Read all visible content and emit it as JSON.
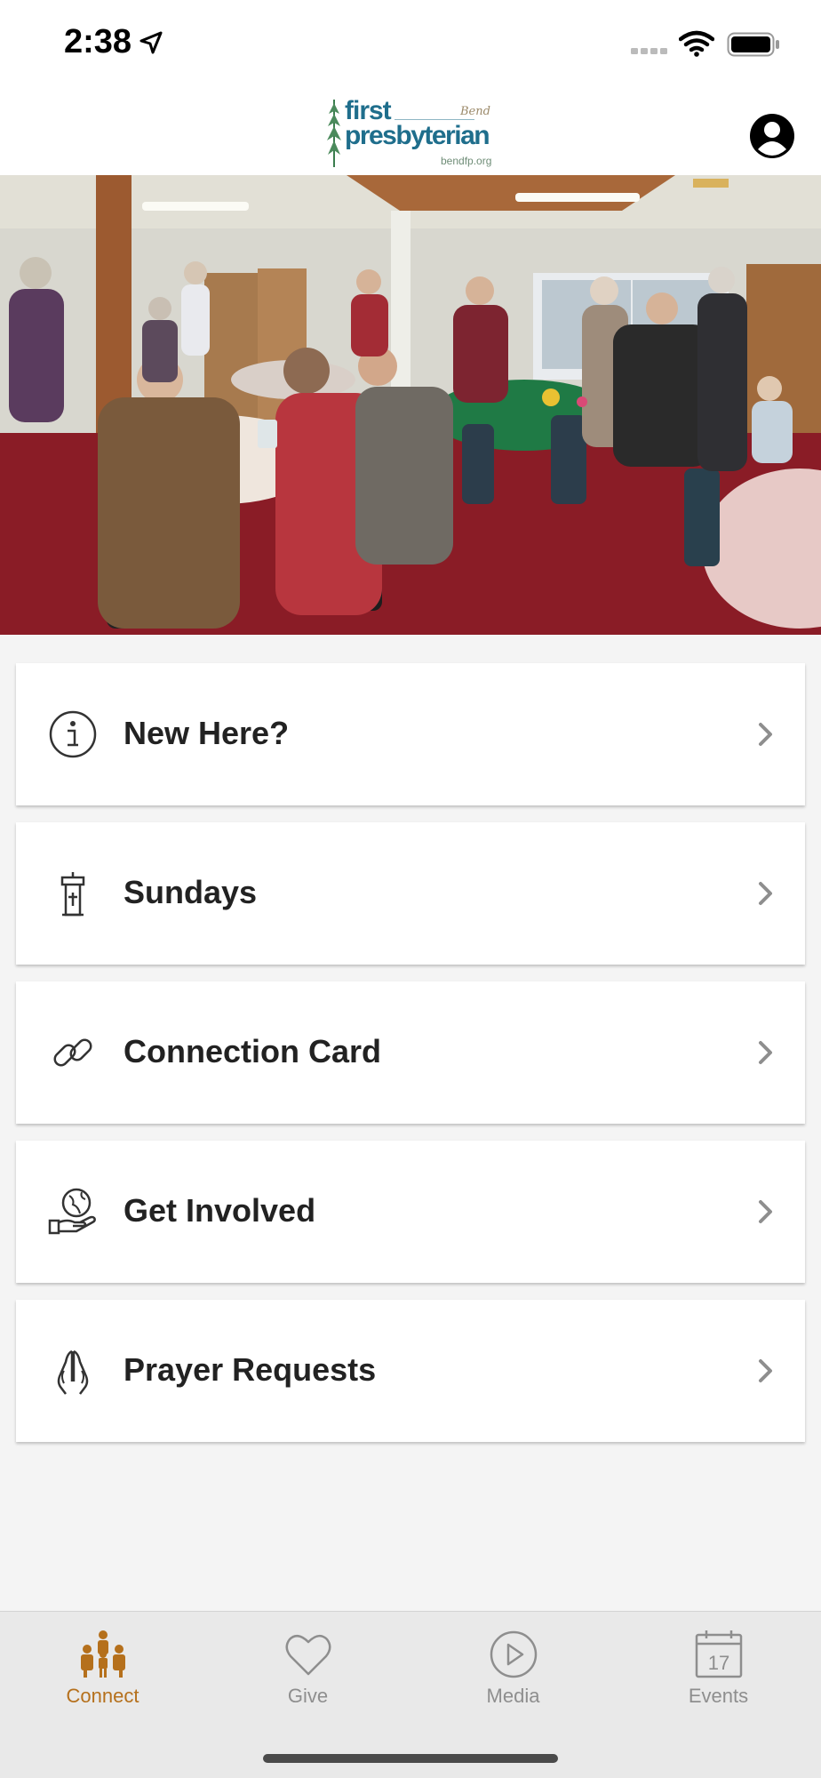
{
  "status_bar": {
    "time": "2:38",
    "icons": [
      "location-arrow-icon",
      "signal-icon",
      "wifi-icon",
      "battery-icon"
    ]
  },
  "header": {
    "logo": {
      "line1": "first",
      "line2": "presbyterian",
      "script": "Bend",
      "url": "bendfp.org"
    },
    "profile_icon": "person-circle-icon"
  },
  "hero": {
    "image": "church fellowship hall photo"
  },
  "menu": [
    {
      "label": "New Here?",
      "icon": "info-circle-icon"
    },
    {
      "label": "Sundays",
      "icon": "pulpit-icon"
    },
    {
      "label": "Connection Card",
      "icon": "link-icon"
    },
    {
      "label": "Get Involved",
      "icon": "globe-hand-icon"
    },
    {
      "label": "Prayer Requests",
      "icon": "praying-hands-icon"
    }
  ],
  "tabs": [
    {
      "label": "Connect",
      "icon": "people-icon",
      "active": true
    },
    {
      "label": "Give",
      "icon": "heart-icon",
      "active": false
    },
    {
      "label": "Media",
      "icon": "play-circle-icon",
      "active": false
    },
    {
      "label": "Events",
      "icon": "calendar-icon",
      "active": false,
      "badge": "17"
    }
  ],
  "colors": {
    "accent": "#b5701c",
    "logo_blue": "#1f6e8c",
    "inactive_tab": "#8e8e8e"
  }
}
